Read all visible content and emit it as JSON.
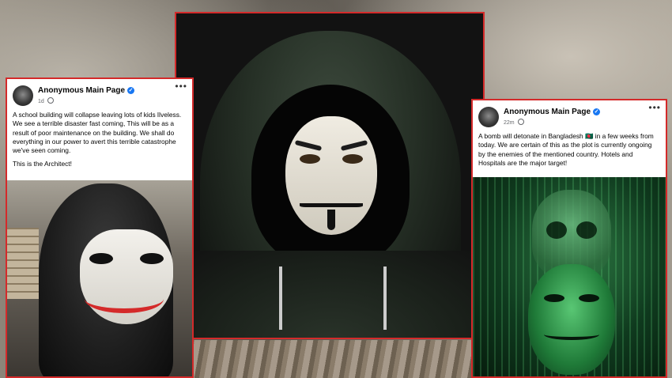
{
  "scene": {
    "title": "Anonymous hacker threat posts collage"
  },
  "post_left": {
    "page_name": "Anonymous Main Page",
    "time": "1d",
    "paragraph1": "A school building will collapse leaving lots of kids lIveless. We see a terrible disaster fast coming, This will be as a result of poor maintenance on the building. We shall do everything in our power to avert this terrible catastrophe we've seen coming.",
    "paragraph2": "This is the Architect!",
    "more": "•••"
  },
  "post_right": {
    "page_name": "Anonymous Main Page",
    "time": "22m",
    "paragraph1": "A bomb will detonate in Bangladesh 🇧🇩 in a few weeks from today. We are certain of this as the plot is currently ongoing by the enemies of the mentioned country. Hotels and Hospitals are the major target!",
    "more": "•••"
  },
  "colors": {
    "frame": "#d42a2a",
    "verified": "#1877f2"
  },
  "icons": {
    "verified": "verified-badge-icon",
    "audience": "globe-icon",
    "menu": "more-options-icon"
  }
}
